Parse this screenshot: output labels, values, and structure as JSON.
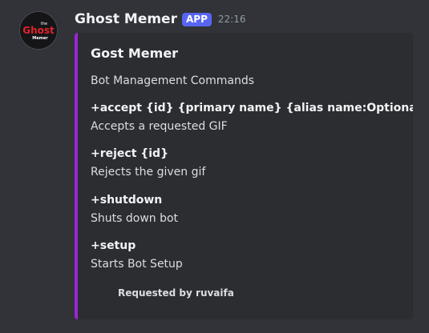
{
  "message": {
    "author": "Ghost Memer",
    "badge": "APP",
    "timestamp": "22:16",
    "avatar_text": {
      "line1": "the",
      "line2": "Ghost",
      "line3": "Memer"
    }
  },
  "embed": {
    "accent_color": "#9b25d6",
    "title": "Gost Memer",
    "description": "Bot Management Commands",
    "fields": [
      {
        "name": "+accept {id} {primary name} {alias name:Optional}",
        "value": "Accepts a requested GIF"
      },
      {
        "name": "+reject {id}",
        "value": "Rejects the given gif"
      },
      {
        "name": "+shutdown",
        "value": "Shuts down bot"
      },
      {
        "name": "+setup",
        "value": "Starts Bot Setup"
      }
    ],
    "footer": "Requested by ruvaifa"
  }
}
